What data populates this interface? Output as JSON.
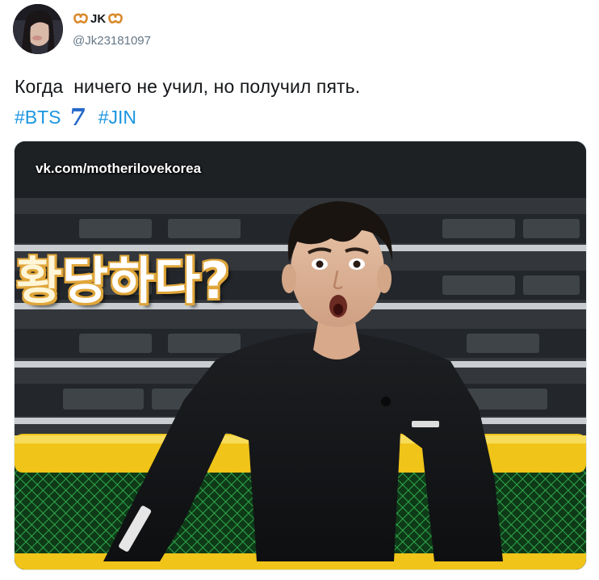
{
  "tweet": {
    "author": {
      "display_name": "JK",
      "handle": "@Jk23181097",
      "name_emoji_left": "pretzel-icon",
      "name_emoji_right": "pretzel-icon"
    },
    "text": "Когда  ничего не учил, но получил пять.",
    "hashtags": [
      "#BTS",
      "#JIN"
    ],
    "hashtag_emoji": "7",
    "colors": {
      "link": "#1b95e0",
      "text": "#14171a",
      "secondary": "#657786"
    },
    "media": {
      "watermark": "vk.com/motherilovekorea",
      "caption_first": "황",
      "caption_rest": "당하다?"
    }
  }
}
